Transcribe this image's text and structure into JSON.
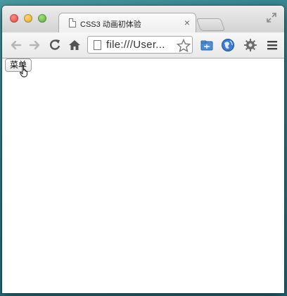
{
  "window": {
    "tab_title": "CSS3 动画初体验",
    "tab_close": "×"
  },
  "toolbar": {
    "address": "file:///User...",
    "icons": [
      "back-icon",
      "forward-icon",
      "reload-icon",
      "home-icon",
      "star-icon",
      "folder-extension-icon",
      "globe-extension-icon",
      "gear-extension-icon",
      "menu-icon"
    ]
  },
  "page": {
    "button_label": "菜单"
  },
  "colors": {
    "close": "#e0443a",
    "minimize": "#e0a42a",
    "maximize": "#53a83a",
    "desktop": "#2f7f8c"
  }
}
